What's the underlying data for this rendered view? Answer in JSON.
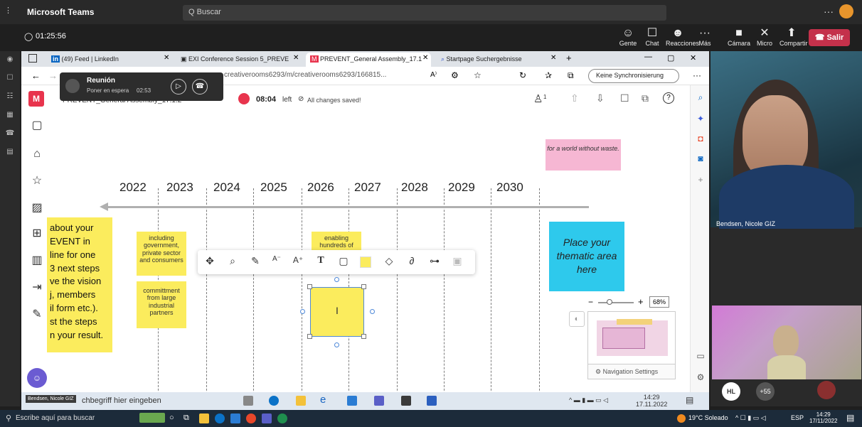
{
  "teams": {
    "app_title": "Microsoft Teams",
    "search_placeholder": "Q Buscar",
    "timer": "01:25:56",
    "controls": {
      "people": "Gente",
      "chat": "Chat",
      "reactions": "Reacciones",
      "more": "Más",
      "camera": "Cámara",
      "mic": "Micro",
      "share": "Compartir",
      "leave": "Salir"
    }
  },
  "browser": {
    "tabs": [
      {
        "label": "(49) Feed | LinkedIn"
      },
      {
        "label": "EXI Conference Session 5_PREVE"
      },
      {
        "label": "PREVENT_General Assembly_17.1"
      },
      {
        "label": "Startpage Suchergebnisse"
      }
    ],
    "url": "creativerooms6293/m/creativerooms6293/166815...",
    "sync_label": "Keine Synchronisierung"
  },
  "meeting_popup": {
    "title": "Reunión",
    "subtitle": "Poner en espera",
    "time": "02:53"
  },
  "board": {
    "board_title": "PREVENT_General Assembly_17.1.2",
    "timer": "08:04",
    "timer_suffix": "left",
    "saved_status": "All changes saved!",
    "participant_count": "1",
    "years": [
      "2022",
      "2023",
      "2024",
      "2025",
      "2026",
      "2027",
      "2028",
      "2029",
      "2030"
    ],
    "big_sticky_lines": [
      "about your",
      "EVENT in",
      "line for one",
      "3 next steps",
      "ve the vision",
      "j, members",
      "il form etc.).",
      "st the steps",
      "n your result."
    ],
    "stickies": {
      "s1": "including government, private sector and consumers",
      "s2": "committment from large industrial partners",
      "s3": "enabling hundreds of"
    },
    "pink_note": "for a world without waste.",
    "blue_note": "Place your thematic area here",
    "zoom_level": "68%",
    "nav_settings": "Navigation Settings",
    "edit_cursor": "I"
  },
  "video": {
    "participant_name": "Bendsen, Nicole GIZ",
    "avatar_initials": "HL",
    "more_count": "+55"
  },
  "inner_taskbar": {
    "search_placeholder": "chbegriff hier eingeben",
    "presenter_tag": "Bendsen, Nicole GIZ",
    "time": "14:29",
    "date": "17.11.2022"
  },
  "outer_taskbar": {
    "search_placeholder": "Escribe aquí para buscar",
    "weather": "19°C Soleado",
    "lang": "ESP",
    "time": "14:29",
    "date": "17/11/2022"
  },
  "colors": {
    "sticky_yellow": "#fbec5d",
    "thematic_blue": "#2ec9ec",
    "pink_note": "#f6b7d3",
    "leave_red": "#c4314b",
    "brand_red": "#e8344d"
  }
}
